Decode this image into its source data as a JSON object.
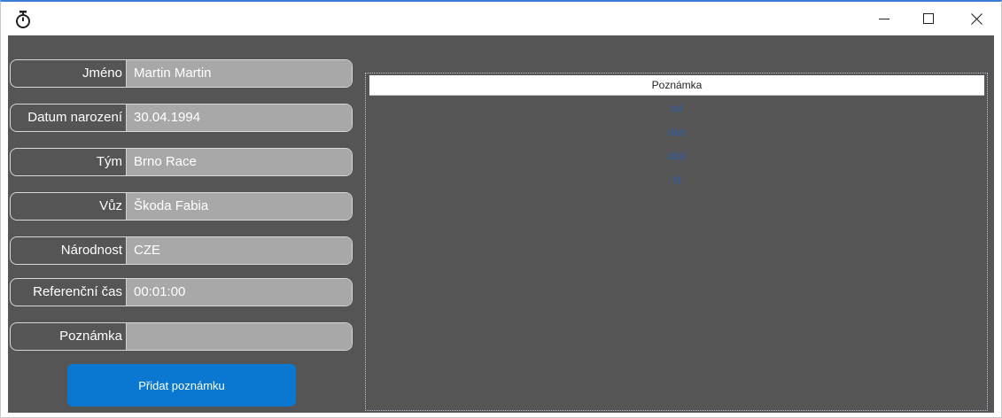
{
  "window": {
    "icon": "stopwatch-icon",
    "controls": {
      "minimize_icon": "minimize-icon",
      "maximize_icon": "maximize-icon",
      "close_icon": "close-icon"
    }
  },
  "form": {
    "fields": [
      {
        "label": "Jméno",
        "value": "Martin Martin"
      },
      {
        "label": "Datum narození",
        "value": "30.04.1994"
      },
      {
        "label": "Tým",
        "value": "Brno Race"
      },
      {
        "label": "Vůz",
        "value": "Škoda Fabia"
      },
      {
        "label": "Národnost",
        "value": "CZE"
      },
      {
        "label": "Referenční čas",
        "value": "00:01:00"
      },
      {
        "label": "Poznámka",
        "value": ""
      }
    ],
    "add_note_label": "Přidat poznámku"
  },
  "notes": {
    "header": "Poznámka",
    "items": [
      "sd",
      "das",
      "ddd",
      "fd"
    ]
  },
  "colors": {
    "background": "#555555",
    "input": "#a8a8a8",
    "accent": "#0a78d0",
    "note_text": "#2e5aa8"
  }
}
